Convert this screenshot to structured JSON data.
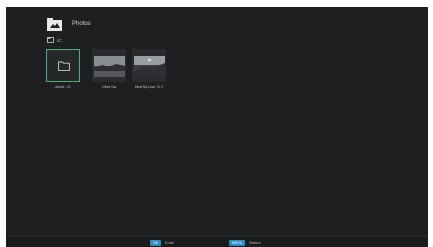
{
  "header": {
    "title": "Photos",
    "icon": "photo-folder-icon",
    "path": "/C:"
  },
  "items": [
    {
      "label": "Adobe - 01",
      "type": "folder",
      "selected": true
    },
    {
      "label": "I Miss You",
      "type": "photo",
      "selected": false
    },
    {
      "label": "Send My Love, To Y",
      "type": "photo",
      "selected": false
    }
  ],
  "footer": {
    "ok_key": "OK",
    "ok_label": "Enter",
    "menu_key": "MENU",
    "menu_label": "Return"
  },
  "colors": {
    "background": "#1e1f21",
    "selection": "#4fb07a",
    "key_badge": "#2a8ec2"
  }
}
